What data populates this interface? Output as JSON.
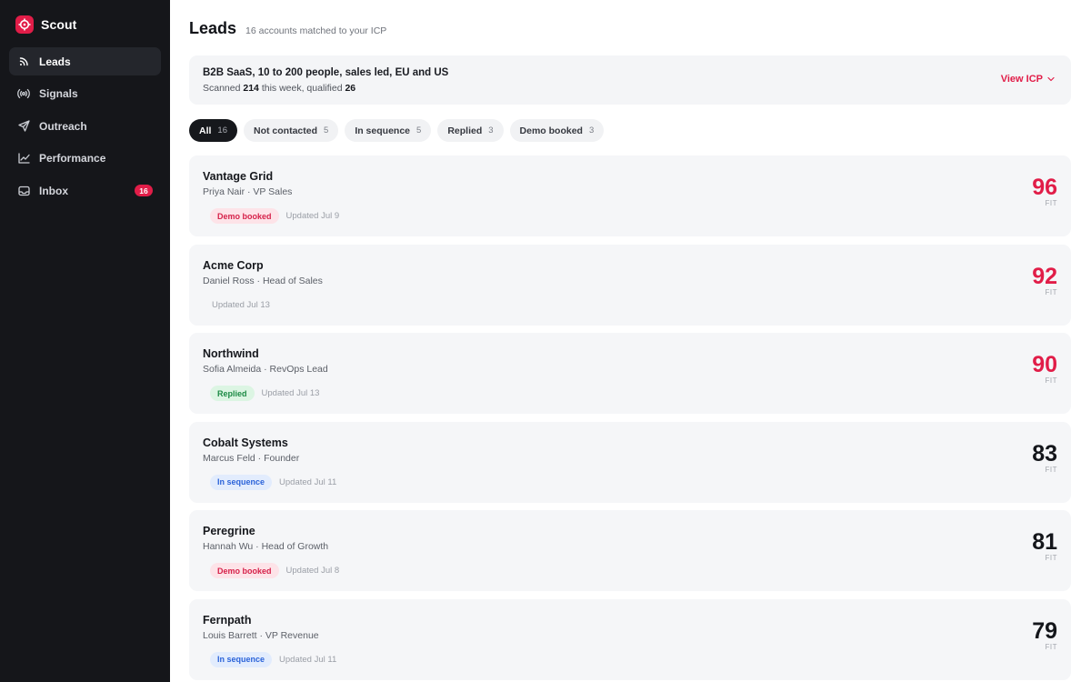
{
  "app": {
    "name": "Scout",
    "accent": "#e11d48"
  },
  "nav": [
    {
      "label": "Leads",
      "icon": "rss-icon",
      "active": true
    },
    {
      "label": "Signals",
      "icon": "broadcast-icon"
    },
    {
      "label": "Outreach",
      "icon": "send-icon"
    },
    {
      "label": "Performance",
      "icon": "chart-line-icon"
    },
    {
      "label": "Inbox",
      "icon": "inbox-icon",
      "badge": "16"
    }
  ],
  "page": {
    "title": "Leads",
    "subtitle": "16 accounts matched to your ICP"
  },
  "icp": {
    "title": "B2B SaaS, 10 to 200 people, sales led, EU and US",
    "scanned_prefix": "Scanned",
    "scanned": "214",
    "mid": "this week, qualified",
    "qualified": "26",
    "link_label": "View ICP"
  },
  "filters": [
    {
      "label": "All",
      "count": "16",
      "active": true
    },
    {
      "label": "Not contacted",
      "count": "5"
    },
    {
      "label": "In sequence",
      "count": "5"
    },
    {
      "label": "Replied",
      "count": "3"
    },
    {
      "label": "Demo booked",
      "count": "3"
    }
  ],
  "leads": [
    {
      "company": "Vantage Grid",
      "contact": "Priya Nair · VP Sales",
      "status": "Demo booked",
      "status_type": "demo",
      "updated": "Updated Jul 9",
      "fit": "96",
      "fit_label": "FIT",
      "hot": true
    },
    {
      "company": "Acme Corp",
      "contact": "Daniel Ross · Head of Sales",
      "status": "",
      "status_type": "",
      "updated": "Updated Jul 13",
      "fit": "92",
      "fit_label": "FIT",
      "hot": true
    },
    {
      "company": "Northwind",
      "contact": "Sofia Almeida · RevOps Lead",
      "status": "Replied",
      "status_type": "replied",
      "updated": "Updated Jul 13",
      "fit": "90",
      "fit_label": "FIT",
      "hot": true
    },
    {
      "company": "Cobalt Systems",
      "contact": "Marcus Feld · Founder",
      "status": "In sequence",
      "status_type": "seq",
      "updated": "Updated Jul 11",
      "fit": "83",
      "fit_label": "FIT",
      "hot": false
    },
    {
      "company": "Peregrine",
      "contact": "Hannah Wu · Head of Growth",
      "status": "Demo booked",
      "status_type": "demo",
      "updated": "Updated Jul 8",
      "fit": "81",
      "fit_label": "FIT",
      "hot": false
    },
    {
      "company": "Fernpath",
      "contact": "Louis Barrett · VP Revenue",
      "status": "In sequence",
      "status_type": "seq",
      "updated": "Updated Jul 11",
      "fit": "79",
      "fit_label": "FIT",
      "hot": false
    }
  ]
}
